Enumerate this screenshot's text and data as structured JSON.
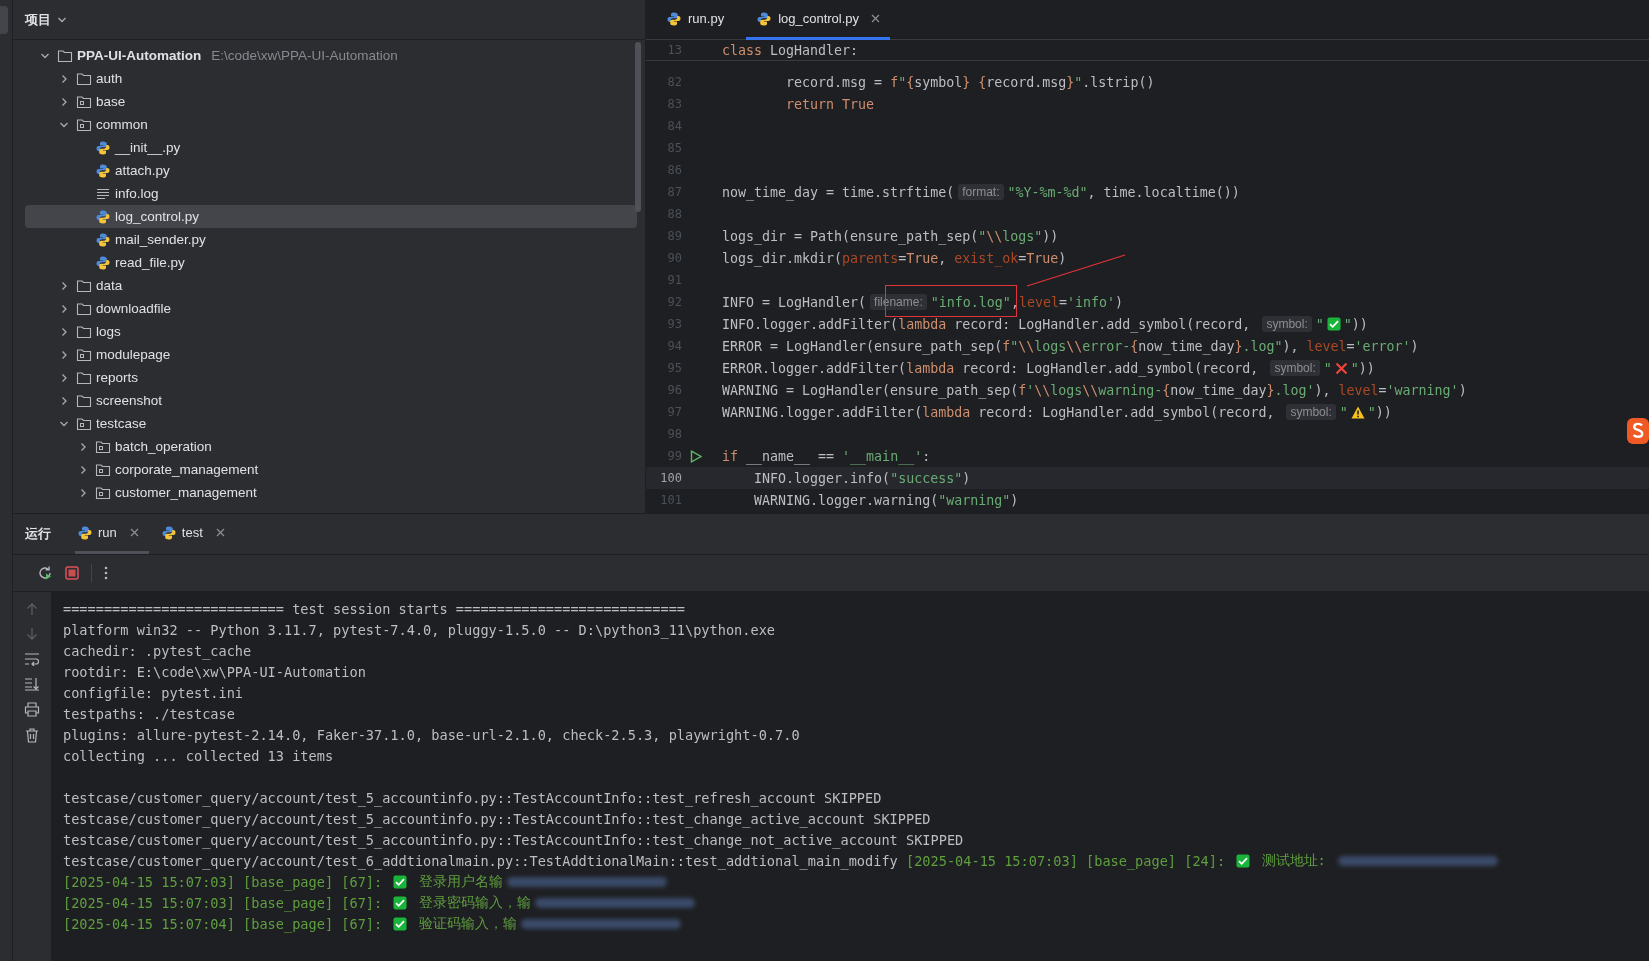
{
  "project_panel": {
    "title": "项目",
    "tree": [
      {
        "name": "PPA-UI-Automation",
        "path": "E:\\code\\xw\\PPA-UI-Automation",
        "kind": "folder",
        "expanded": true,
        "selected": false,
        "children": [
          {
            "name": "auth",
            "kind": "folder",
            "expanded": false,
            "selected": false
          },
          {
            "name": "base",
            "kind": "package",
            "expanded": false,
            "selected": false
          },
          {
            "name": "common",
            "kind": "package",
            "expanded": true,
            "selected": false,
            "children": [
              {
                "name": "__init__.py",
                "kind": "python",
                "selected": false
              },
              {
                "name": "attach.py",
                "kind": "python",
                "selected": false
              },
              {
                "name": "info.log",
                "kind": "log",
                "selected": false
              },
              {
                "name": "log_control.py",
                "kind": "python",
                "selected": true
              },
              {
                "name": "mail_sender.py",
                "kind": "python",
                "selected": false
              },
              {
                "name": "read_file.py",
                "kind": "python",
                "selected": false
              }
            ]
          },
          {
            "name": "data",
            "kind": "folder",
            "expanded": false,
            "selected": false
          },
          {
            "name": "downloadfile",
            "kind": "folder",
            "expanded": false,
            "selected": false
          },
          {
            "name": "logs",
            "kind": "folder",
            "expanded": false,
            "selected": false
          },
          {
            "name": "modulepage",
            "kind": "package",
            "expanded": false,
            "selected": false
          },
          {
            "name": "reports",
            "kind": "folder",
            "expanded": false,
            "selected": false
          },
          {
            "name": "screenshot",
            "kind": "folder",
            "expanded": false,
            "selected": false
          },
          {
            "name": "testcase",
            "kind": "package",
            "expanded": true,
            "selected": false,
            "children": [
              {
                "name": "batch_operation",
                "kind": "package",
                "expanded": false,
                "selected": false
              },
              {
                "name": "corporate_management",
                "kind": "package",
                "expanded": false,
                "selected": false
              },
              {
                "name": "customer_management",
                "kind": "package",
                "expanded": false,
                "selected": false
              }
            ]
          }
        ]
      }
    ]
  },
  "editor": {
    "tabs": [
      {
        "label": "run.py",
        "selected": false,
        "closable": false
      },
      {
        "label": "log_control.py",
        "selected": true,
        "closable": true
      }
    ],
    "sticky_line": {
      "n": "13",
      "tokens": [
        {
          "kind": "keyword",
          "t": "class"
        },
        {
          "kind": "plain",
          "t": " LogHandler:"
        }
      ]
    },
    "lines": [
      {
        "n": "82",
        "current": false,
        "run_marker": false,
        "tokens": [
          {
            "kind": "plain",
            "t": "        record.msg = "
          },
          {
            "kind": "keyword",
            "t": "f"
          },
          {
            "kind": "string",
            "t": "\""
          },
          {
            "kind": "brace",
            "t": "{"
          },
          {
            "kind": "plain",
            "t": "symbol"
          },
          {
            "kind": "brace",
            "t": "} {"
          },
          {
            "kind": "plain",
            "t": "record.msg"
          },
          {
            "kind": "brace",
            "t": "}"
          },
          {
            "kind": "string",
            "t": "\""
          },
          {
            "kind": "plain",
            "t": ".lstrip()"
          }
        ]
      },
      {
        "n": "83",
        "current": false,
        "run_marker": false,
        "tokens": [
          {
            "kind": "keyword",
            "t": "        return True"
          }
        ]
      },
      {
        "n": "84",
        "current": false,
        "run_marker": false
      },
      {
        "n": "85",
        "current": false,
        "run_marker": false
      },
      {
        "n": "86",
        "current": false,
        "run_marker": false
      },
      {
        "n": "87",
        "current": false,
        "run_marker": false,
        "tokens": [
          {
            "kind": "plain",
            "t": "now_time_day = time.strftime("
          },
          {
            "kind": "hint",
            "t": "format:"
          },
          {
            "kind": "string",
            "t": "\"%Y-%m-%d\""
          },
          {
            "kind": "plain",
            "t": ", time.localtime())"
          }
        ]
      },
      {
        "n": "88",
        "current": false,
        "run_marker": false
      },
      {
        "n": "89",
        "current": false,
        "run_marker": false,
        "tokens": [
          {
            "kind": "plain",
            "t": "logs_dir = Path(ensure_path_sep("
          },
          {
            "kind": "string",
            "t": "\""
          },
          {
            "kind": "escape",
            "t": "\\\\"
          },
          {
            "kind": "string",
            "t": "logs\""
          },
          {
            "kind": "plain",
            "t": "))"
          }
        ]
      },
      {
        "n": "90",
        "current": false,
        "run_marker": false,
        "tokens": [
          {
            "kind": "plain",
            "t": "logs_dir.mkdir("
          },
          {
            "kind": "argument",
            "t": "parents"
          },
          {
            "kind": "plain",
            "t": "="
          },
          {
            "kind": "keyword",
            "t": "True"
          },
          {
            "kind": "plain",
            "t": ", "
          },
          {
            "kind": "argument",
            "t": "exist_ok"
          },
          {
            "kind": "plain",
            "t": "="
          },
          {
            "kind": "keyword",
            "t": "True"
          },
          {
            "kind": "plain",
            "t": ")"
          }
        ]
      },
      {
        "n": "91",
        "current": false,
        "run_marker": false
      },
      {
        "n": "92",
        "current": false,
        "run_marker": false,
        "tokens": [
          {
            "kind": "plain",
            "t": "INFO = LogHandler("
          },
          {
            "kind": "hint",
            "t": "filename:"
          },
          {
            "kind": "string",
            "t": "\"info.log\""
          },
          {
            "kind": "plain",
            "t": ","
          },
          {
            "kind": "argument",
            "t": "level"
          },
          {
            "kind": "plain",
            "t": "="
          },
          {
            "kind": "string",
            "t": "'info'"
          },
          {
            "kind": "plain",
            "t": ")"
          }
        ]
      },
      {
        "n": "93",
        "current": false,
        "run_marker": false,
        "tokens": [
          {
            "kind": "plain",
            "t": "INFO.logger.addFilter("
          },
          {
            "kind": "keyword",
            "t": "lambda"
          },
          {
            "kind": "plain",
            "t": " record: LogHandler.add_symbol(record, "
          },
          {
            "kind": "hint",
            "t": "symbol:"
          },
          {
            "kind": "string",
            "t": "\""
          },
          {
            "kind": "check_mark"
          },
          {
            "kind": "string",
            "t": "\""
          },
          {
            "kind": "plain",
            "t": "))"
          }
        ]
      },
      {
        "n": "94",
        "current": false,
        "run_marker": false,
        "tokens": [
          {
            "kind": "plain",
            "t": "ERROR = LogHandler(ensure_path_sep("
          },
          {
            "kind": "keyword",
            "t": "f"
          },
          {
            "kind": "string",
            "t": "\""
          },
          {
            "kind": "escape",
            "t": "\\\\"
          },
          {
            "kind": "string",
            "t": "logs"
          },
          {
            "kind": "escape",
            "t": "\\\\"
          },
          {
            "kind": "string",
            "t": "error-"
          },
          {
            "kind": "brace",
            "t": "{"
          },
          {
            "kind": "plain",
            "t": "now_time_day"
          },
          {
            "kind": "brace",
            "t": "}"
          },
          {
            "kind": "string",
            "t": ".log\""
          },
          {
            "kind": "plain",
            "t": "), "
          },
          {
            "kind": "argument",
            "t": "level"
          },
          {
            "kind": "plain",
            "t": "="
          },
          {
            "kind": "string",
            "t": "'error'"
          },
          {
            "kind": "plain",
            "t": ")"
          }
        ]
      },
      {
        "n": "95",
        "current": false,
        "run_marker": false,
        "tokens": [
          {
            "kind": "plain",
            "t": "ERROR.logger.addFilter("
          },
          {
            "kind": "keyword",
            "t": "lambda"
          },
          {
            "kind": "plain",
            "t": " record: LogHandler.add_symbol(record, "
          },
          {
            "kind": "hint",
            "t": "symbol:"
          },
          {
            "kind": "string",
            "t": "\""
          },
          {
            "kind": "cross_mark"
          },
          {
            "kind": "string",
            "t": "\""
          },
          {
            "kind": "plain",
            "t": "))"
          }
        ]
      },
      {
        "n": "96",
        "current": false,
        "run_marker": false,
        "tokens": [
          {
            "kind": "plain",
            "t": "WARNING = LogHandler(ensure_path_sep("
          },
          {
            "kind": "keyword",
            "t": "f"
          },
          {
            "kind": "string",
            "t": "'"
          },
          {
            "kind": "escape",
            "t": "\\\\"
          },
          {
            "kind": "string",
            "t": "logs"
          },
          {
            "kind": "escape",
            "t": "\\\\"
          },
          {
            "kind": "string",
            "t": "warning-"
          },
          {
            "kind": "brace",
            "t": "{"
          },
          {
            "kind": "plain",
            "t": "now_time_day"
          },
          {
            "kind": "brace",
            "t": "}"
          },
          {
            "kind": "string",
            "t": ".log'"
          },
          {
            "kind": "plain",
            "t": "), "
          },
          {
            "kind": "argument",
            "t": "level"
          },
          {
            "kind": "plain",
            "t": "="
          },
          {
            "kind": "string",
            "t": "'warning'"
          },
          {
            "kind": "plain",
            "t": ")"
          }
        ]
      },
      {
        "n": "97",
        "current": false,
        "run_marker": false,
        "tokens": [
          {
            "kind": "plain",
            "t": "WARNING.logger.addFilter("
          },
          {
            "kind": "keyword",
            "t": "lambda"
          },
          {
            "kind": "plain",
            "t": " record: LogHandler.add_symbol(record, "
          },
          {
            "kind": "hint",
            "t": "symbol:"
          },
          {
            "kind": "string",
            "t": "\""
          },
          {
            "kind": "warning_sign"
          },
          {
            "kind": "string",
            "t": "\""
          },
          {
            "kind": "plain",
            "t": "))"
          }
        ]
      },
      {
        "n": "98",
        "current": false,
        "run_marker": false
      },
      {
        "n": "99",
        "current": false,
        "run_marker": true,
        "tokens": [
          {
            "kind": "keyword",
            "t": "if"
          },
          {
            "kind": "plain",
            "t": " __name__ == "
          },
          {
            "kind": "string",
            "t": "'__main__'"
          },
          {
            "kind": "plain",
            "t": ":"
          }
        ]
      },
      {
        "n": "100",
        "current": true,
        "run_marker": false,
        "tokens": [
          {
            "kind": "plain",
            "t": "    INFO.logger.info("
          },
          {
            "kind": "string",
            "t": "\"success\""
          },
          {
            "kind": "plain",
            "t": ")"
          }
        ]
      },
      {
        "n": "101",
        "current": false,
        "run_marker": false,
        "tokens": [
          {
            "kind": "plain",
            "t": "    WARNING.logger.warning("
          },
          {
            "kind": "string",
            "t": "\"warning\""
          },
          {
            "kind": "plain",
            "t": ")"
          }
        ]
      }
    ]
  },
  "run_panel": {
    "title": "运行",
    "tabs": [
      {
        "label": "run",
        "selected": true
      },
      {
        "label": "test",
        "selected": false
      }
    ],
    "console": [
      {
        "segments": [
          {
            "kind": "plain",
            "t": "=========================== test session starts ============================"
          }
        ]
      },
      {
        "segments": [
          {
            "kind": "plain",
            "t": "platform win32 -- Python 3.11.7, pytest-7.4.0, pluggy-1.5.0 -- D:\\python3_11\\python.exe"
          }
        ]
      },
      {
        "segments": [
          {
            "kind": "plain",
            "t": "cachedir: .pytest_cache"
          }
        ]
      },
      {
        "segments": [
          {
            "kind": "plain",
            "t": "rootdir: E:\\code\\xw\\PPA-UI-Automation"
          }
        ]
      },
      {
        "segments": [
          {
            "kind": "plain",
            "t": "configfile: pytest.ini"
          }
        ]
      },
      {
        "segments": [
          {
            "kind": "plain",
            "t": "testpaths: ./testcase"
          }
        ]
      },
      {
        "segments": [
          {
            "kind": "plain",
            "t": "plugins: allure-pytest-2.14.0, Faker-37.1.0, base-url-2.1.0, check-2.5.3, playwright-0.7.0"
          }
        ]
      },
      {
        "segments": [
          {
            "kind": "plain",
            "t": "collecting ... collected 13 items"
          }
        ]
      },
      {
        "blank_before": true,
        "segments": [
          {
            "kind": "plain",
            "t": "testcase/customer_query/account/test_5_accountinfo.py::TestAccountInfo::test_refresh_account SKIPPED"
          }
        ]
      },
      {
        "segments": [
          {
            "kind": "plain",
            "t": "testcase/customer_query/account/test_5_accountinfo.py::TestAccountInfo::test_change_active_account SKIPPED"
          }
        ]
      },
      {
        "segments": [
          {
            "kind": "plain",
            "t": "testcase/customer_query/account/test_5_accountinfo.py::TestAccountInfo::test_change_not_active_account SKIPPED"
          }
        ]
      },
      {
        "segments": [
          {
            "kind": "plain",
            "t": "testcase/customer_query/account/test_6_addtionalmain.py::TestAddtionalMain::test_addtional_main_modify "
          },
          {
            "kind": "log",
            "t": "[2025-04-15 15:07:03] [base_page] [24]: "
          },
          {
            "kind": "check"
          },
          {
            "kind": "log",
            "t": " 测试地址: "
          },
          {
            "kind": "redacted"
          }
        ]
      },
      {
        "segments": [
          {
            "kind": "log",
            "t": "[2025-04-15 15:07:03] [base_page] [67]: "
          },
          {
            "kind": "check"
          },
          {
            "kind": "log",
            "t": " 登录用户名输"
          },
          {
            "kind": "redacted"
          }
        ]
      },
      {
        "segments": [
          {
            "kind": "log",
            "t": "[2025-04-15 15:07:03] [base_page] [67]: "
          },
          {
            "kind": "check"
          },
          {
            "kind": "log",
            "t": " 登录密码输入，输"
          },
          {
            "kind": "redacted"
          }
        ]
      },
      {
        "segments": [
          {
            "kind": "log",
            "t": "[2025-04-15 15:07:04] [base_page] [67]: "
          },
          {
            "kind": "check"
          },
          {
            "kind": "log",
            "t": " 验证码输入，输"
          },
          {
            "kind": "redacted"
          }
        ]
      }
    ]
  }
}
